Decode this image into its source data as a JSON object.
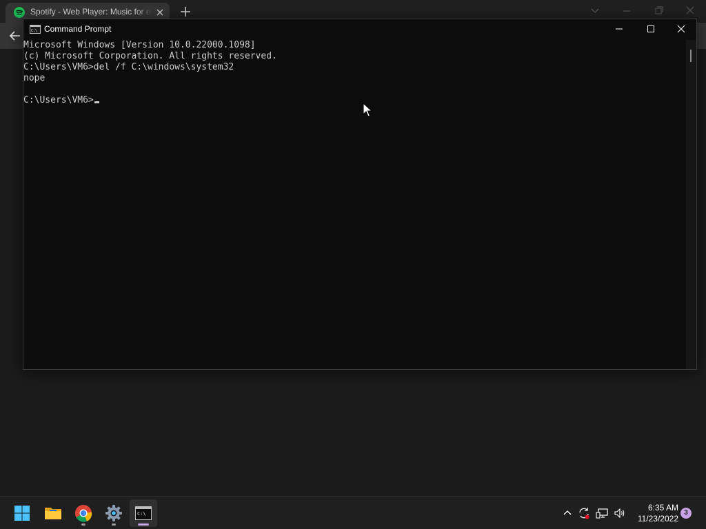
{
  "browser": {
    "tab_title": "Spotify - Web Player: Music for everyone",
    "favicon": "spotify-icon",
    "accent": "#1db954"
  },
  "cmd": {
    "title": "Command Prompt",
    "lines": [
      "Microsoft Windows [Version 10.0.22000.1098]",
      "(c) Microsoft Corporation. All rights reserved.",
      "C:\\Users\\VM6>del /f C:\\windows\\system32",
      "nope",
      "",
      "C:\\Users\\VM6>"
    ],
    "background": "#0c0c0c",
    "foreground": "#cccccc"
  },
  "taskbar": {
    "apps": [
      {
        "name": "start-button",
        "icon": "windows-logo-icon"
      },
      {
        "name": "file-explorer",
        "icon": "folder-icon"
      },
      {
        "name": "chrome",
        "icon": "chrome-icon"
      },
      {
        "name": "settings",
        "icon": "gear-icon"
      },
      {
        "name": "command-prompt",
        "icon": "terminal-icon"
      }
    ],
    "clock_time": "6:35 AM",
    "clock_date": "11/23/2022",
    "notification_count": "3"
  }
}
